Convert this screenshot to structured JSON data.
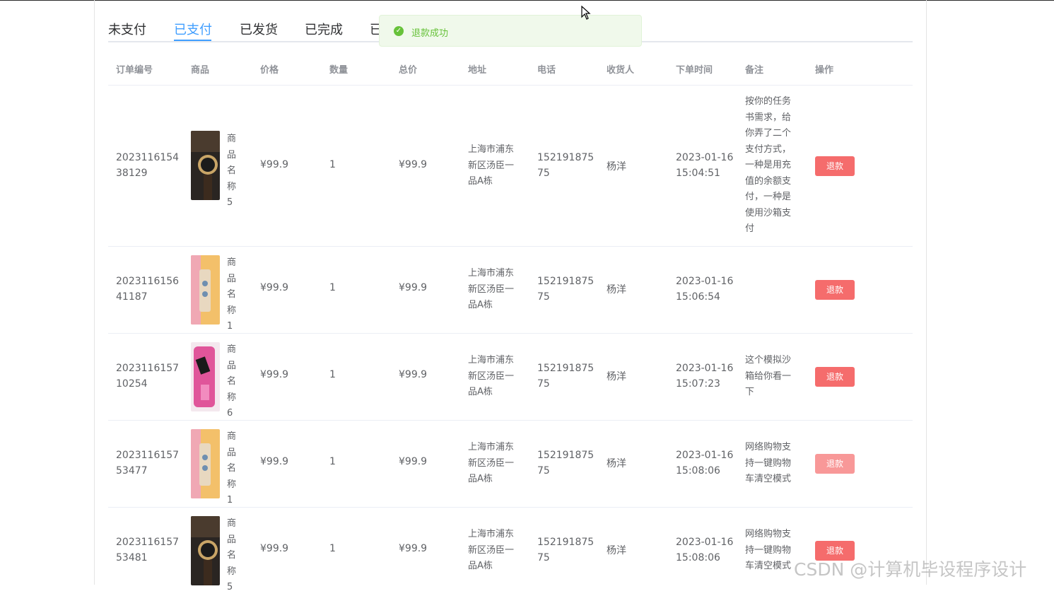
{
  "tabs": [
    {
      "label": "未支付",
      "active": false
    },
    {
      "label": "已支付",
      "active": true
    },
    {
      "label": "已发货",
      "active": false
    },
    {
      "label": "已完成",
      "active": false
    },
    {
      "label": "已",
      "active": false
    }
  ],
  "toast": {
    "message": "退款成功",
    "icon": "check-circle-icon",
    "color": "#67c23a"
  },
  "columns": [
    "订单编号",
    "商品",
    "价格",
    "数量",
    "总价",
    "地址",
    "电话",
    "收货人",
    "下单时间",
    "备注",
    "操作"
  ],
  "rows": [
    {
      "order_line1": "2023116154",
      "order_line2": "38129",
      "product_name": "商品名称5",
      "product_icon": "watch-image",
      "price": "¥99.9",
      "qty": "1",
      "total": "¥99.9",
      "address": "上海市浦东新区汤臣一品A栋",
      "phone_line1": "152191875",
      "phone_line2": "75",
      "receiver": "杨洋",
      "date": "2023-01-16",
      "time": "15:04:51",
      "note": "按你的任务书需求，给你弄了二个支付方式，一种是用充值的余额支付，一种是使用沙箱支付",
      "action": "退款"
    },
    {
      "order_line1": "2023116156",
      "order_line2": "41187",
      "product_name": "商品名称1",
      "product_icon": "phone-case-image",
      "price": "¥99.9",
      "qty": "1",
      "total": "¥99.9",
      "address": "上海市浦东新区汤臣一品A栋",
      "phone_line1": "152191875",
      "phone_line2": "75",
      "receiver": "杨洋",
      "date": "2023-01-16",
      "time": "15:06:54",
      "note": "",
      "action": "退款"
    },
    {
      "order_line1": "2023116157",
      "order_line2": "10254",
      "product_name": "商品名称6",
      "product_icon": "pink-phone-image",
      "price": "¥99.9",
      "qty": "1",
      "total": "¥99.9",
      "address": "上海市浦东新区汤臣一品A栋",
      "phone_line1": "152191875",
      "phone_line2": "75",
      "receiver": "杨洋",
      "date": "2023-01-16",
      "time": "15:07:23",
      "note": "这个模拟沙箱给你看一下",
      "action": "退款"
    },
    {
      "order_line1": "2023116157",
      "order_line2": "53477",
      "product_name": "商品名称1",
      "product_icon": "phone-case-image",
      "price": "¥99.9",
      "qty": "1",
      "total": "¥99.9",
      "address": "上海市浦东新区汤臣一品A栋",
      "phone_line1": "152191875",
      "phone_line2": "75",
      "receiver": "杨洋",
      "date": "2023-01-16",
      "time": "15:08:06",
      "note": "网络购物支持一键购物车清空模式",
      "action": "退款"
    },
    {
      "order_line1": "2023116157",
      "order_line2": "53481",
      "product_name": "商品名称5",
      "product_icon": "watch-image",
      "price": "¥99.9",
      "qty": "1",
      "total": "¥99.9",
      "address": "上海市浦东新区汤臣一品A栋",
      "phone_line1": "152191875",
      "phone_line2": "75",
      "receiver": "杨洋",
      "date": "2023-01-16",
      "time": "15:08:06",
      "note": "网络购物支持一键购物车清空模式",
      "action": "退款"
    }
  ],
  "colors": {
    "primary": "#409eff",
    "danger": "#f56c6c",
    "success": "#67c23a"
  },
  "watermark": "CSDN @计算机毕设程序设计"
}
